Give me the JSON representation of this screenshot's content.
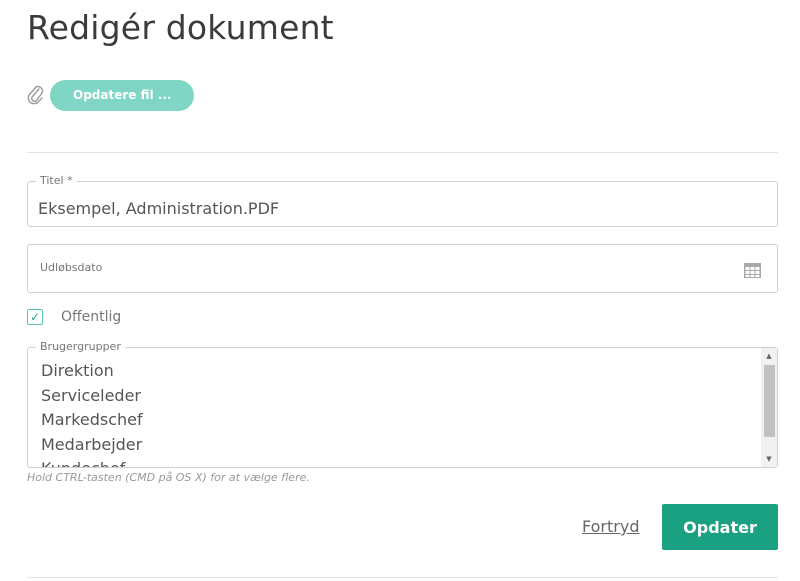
{
  "page": {
    "title": "Redigér dokument"
  },
  "attachment": {
    "update_file_label": "Opdatere fil ..."
  },
  "form": {
    "title_field": {
      "label": "Titel *",
      "value": "Eksempel, Administration.PDF"
    },
    "expiry_field": {
      "label": "Udløbsdato"
    },
    "public_checkbox": {
      "label": "Offentlig",
      "checked": true,
      "check_mark": "✓"
    },
    "user_groups": {
      "label": "Brugergrupper",
      "options": [
        "Direktion",
        "Serviceleder",
        "Markedschef",
        "Medarbejder",
        "Kundechef"
      ]
    },
    "hint": "Hold CTRL-tasten (CMD på OS X) for at vælge flere."
  },
  "actions": {
    "cancel_label": "Fortryd",
    "submit_label": "Opdater"
  },
  "colors": {
    "accent": "#1aa181",
    "accent_light": "#7fd6c4",
    "checkbox_border": "#5cc6ad"
  },
  "icons": {
    "attachment": "paperclip-icon",
    "date_picker": "calendar-icon"
  }
}
